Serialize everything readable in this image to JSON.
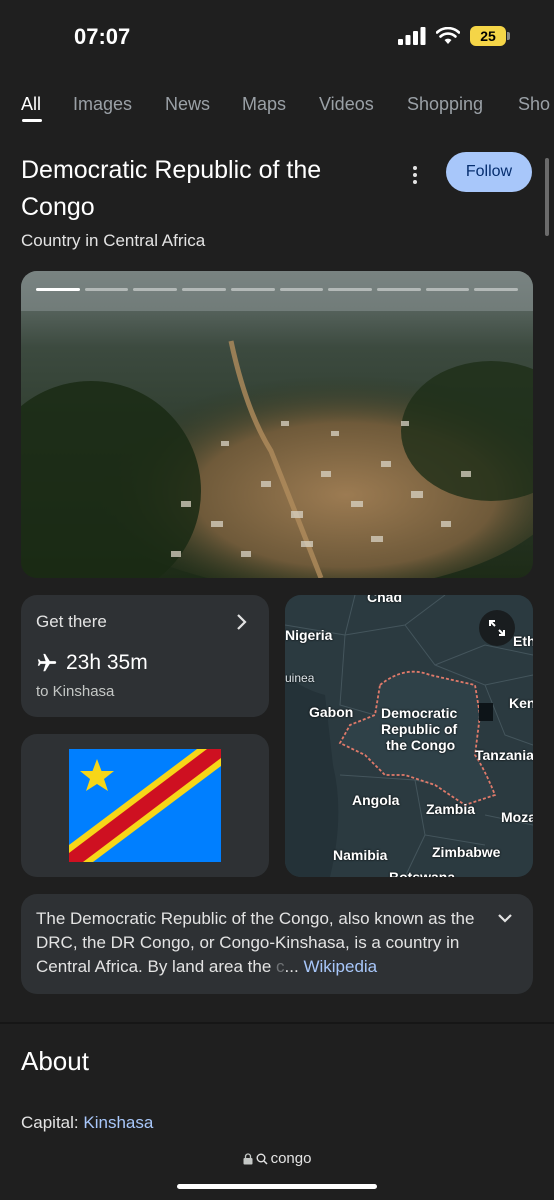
{
  "status": {
    "time": "07:07",
    "battery": "25"
  },
  "tabs": [
    {
      "label": "All",
      "active": true
    },
    {
      "label": "Images"
    },
    {
      "label": "News"
    },
    {
      "label": "Maps"
    },
    {
      "label": "Videos"
    },
    {
      "label": "Shopping"
    },
    {
      "label": "Sho"
    }
  ],
  "entity": {
    "title": "Democratic Republic of the Congo",
    "subtitle": "Country in Central Africa",
    "follow_label": "Follow"
  },
  "get_there": {
    "title": "Get there",
    "duration": "23h 35m",
    "destination": "to Kinshasa"
  },
  "map": {
    "labels": {
      "chad": "Chad",
      "nigeria": "Nigeria",
      "ethiopia": "Eth",
      "guinea": "uinea",
      "gabon": "Gabon",
      "kenya": "Ken",
      "drc_line1": "Democratic",
      "drc_line2": "Republic of",
      "drc_line3": "the Congo",
      "tanzania": "Tanzania",
      "angola": "Angola",
      "zambia": "Zambia",
      "mozambique": "Moza",
      "namibia": "Namibia",
      "zimbabwe": "Zimbabwe",
      "botswana": "Botswana"
    }
  },
  "description": {
    "text": "The Democratic Republic of the Congo, also known as the DRC, the DR Congo, or Congo-Kinshasa, is a country in Central Africa. By land area the",
    "fade": " c",
    "ellipsis": "... ",
    "source": "Wikipedia"
  },
  "about": {
    "title": "About",
    "capital_label": "Capital: ",
    "capital_value": "Kinshasa"
  },
  "url_bar": {
    "query": "congo"
  },
  "colors": {
    "accent_blue": "#a8c7fa",
    "card_bg": "#2e3134",
    "page_bg": "#1f1f1f",
    "flag_blue": "#007fff",
    "flag_red": "#ce1021",
    "flag_yellow": "#f7d618"
  }
}
